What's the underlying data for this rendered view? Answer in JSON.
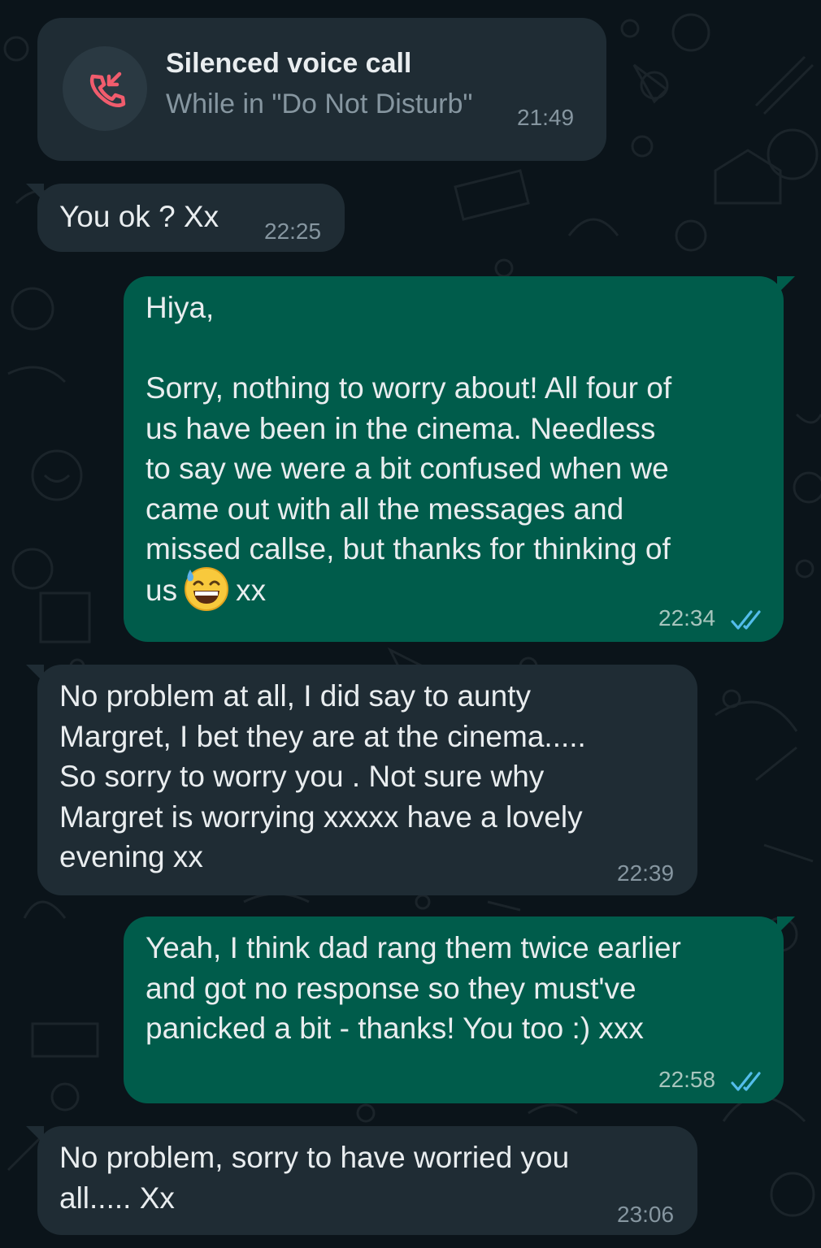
{
  "missed_call": {
    "title": "Silenced voice call",
    "subtitle": "While in \"Do Not Disturb\"",
    "time": "21:49",
    "icon": "missed-call-icon",
    "icon_color": "#f15c6d"
  },
  "messages": [
    {
      "direction": "incoming",
      "text": "You ok ? Xx",
      "time": "22:25"
    },
    {
      "direction": "outgoing",
      "text_before_emoji": "Hiya,\n\nSorry, nothing to worry about! All four of\nus have been in the cinema. Needless\nto say we were a bit confused when we\ncame out with all the messages and\nmissed callse, but thanks for thinking of\nus",
      "emoji": "grinning-sweat-emoji",
      "text_after_emoji": "xx",
      "time": "22:34",
      "status": "read"
    },
    {
      "direction": "incoming",
      "text": "No problem at all, I did say to aunty\nMargret, I bet they are at the cinema.....\nSo sorry to worry you . Not sure why\nMargret is worrying xxxxx have a lovely\nevening xx",
      "time": "22:39"
    },
    {
      "direction": "outgoing",
      "text": "Yeah, I think dad rang them twice earlier\nand got no response so they must've\npanicked a bit - thanks! You too :) xxx",
      "time": "22:58",
      "status": "read"
    },
    {
      "direction": "incoming",
      "text": "No problem, sorry to have worried you\nall.....  Xx",
      "time": "23:06"
    }
  ],
  "colors": {
    "background": "#0b141a",
    "incoming_bubble": "#1f2c34",
    "outgoing_bubble": "#005c4b",
    "read_ticks": "#53bdeb"
  }
}
